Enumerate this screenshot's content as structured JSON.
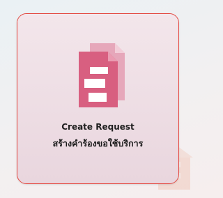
{
  "card": {
    "title": "Create Request",
    "subtitle": "สร้างคำร้องขอใช้บริการ",
    "icon": "document-form-icon",
    "border_color": "#e4473f",
    "icon_color": "#d85f80"
  }
}
